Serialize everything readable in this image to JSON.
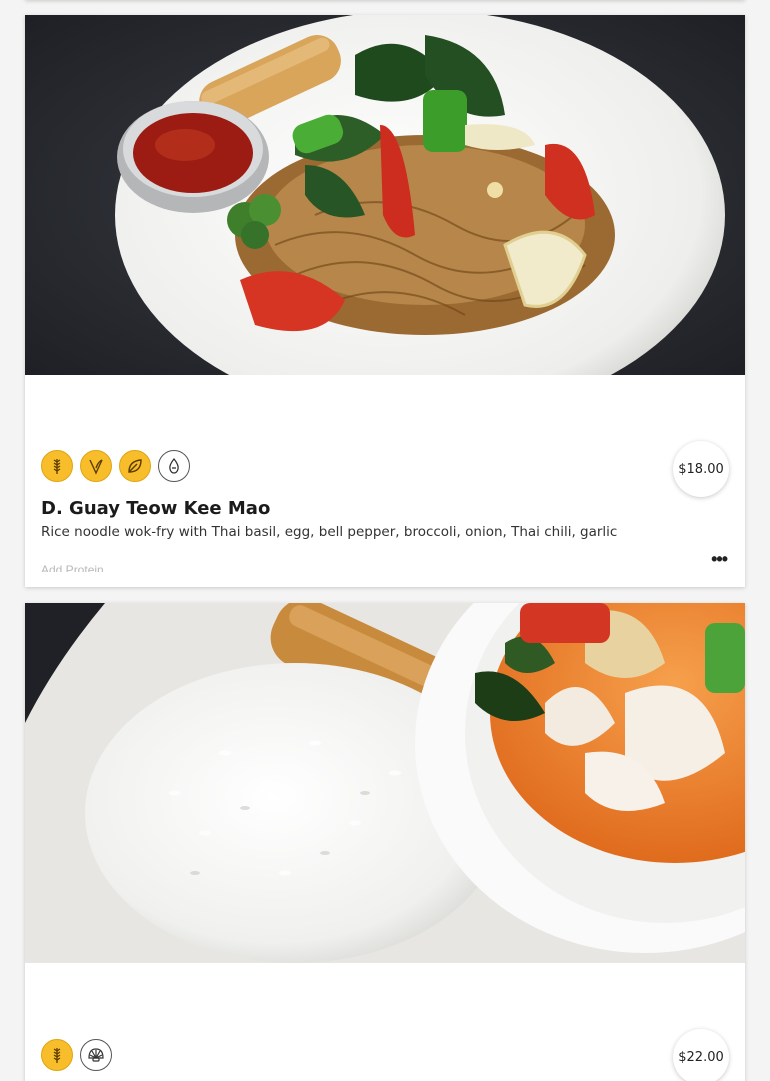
{
  "menu": {
    "items": [
      {
        "name": "D. Guay Teow Kee Mao",
        "description": "Rice noodle wok-fry with Thai basil, egg, bell pepper, broccoli, onion, Thai chili, garlic",
        "price": "$18.00",
        "addon_hint": "Add Protein",
        "more_label": "•••",
        "diet_icons": [
          "gluten-icon",
          "vegan-icon",
          "vegetarian-icon",
          "egg-icon"
        ],
        "photo_alt": "drunken noodles on a white plate"
      },
      {
        "price": "$22.00",
        "diet_icons": [
          "gluten-icon",
          "shellfish-icon"
        ],
        "photo_alt": "red curry with rice and spring roll"
      }
    ]
  },
  "colors": {
    "diet_badge": "#f7bd2b",
    "card_bg": "#ffffff",
    "page_bg": "#f4f4f4"
  }
}
